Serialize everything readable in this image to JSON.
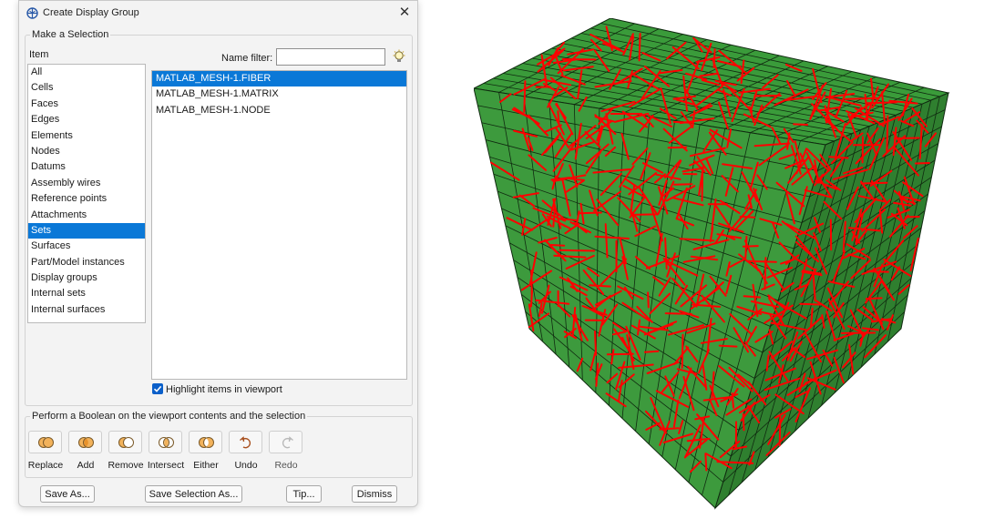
{
  "dialog": {
    "title": "Create Display Group",
    "make_selection": "Make a Selection",
    "item_label": "Item",
    "items": [
      "All",
      "Cells",
      "Faces",
      "Edges",
      "Elements",
      "Nodes",
      "Datums",
      "Assembly wires",
      "Reference points",
      "Attachments",
      "Sets",
      "Surfaces",
      "Part/Model instances",
      "Display groups",
      "Internal sets",
      "Internal surfaces"
    ],
    "selected_item": "Sets",
    "name_filter_label": "Name filter:",
    "name_filter_value": "",
    "sets": [
      "MATLAB_MESH-1.FIBER",
      "MATLAB_MESH-1.MATRIX",
      "MATLAB_MESH-1.NODE"
    ],
    "selected_set": "MATLAB_MESH-1.FIBER",
    "highlight_label": "Highlight items in viewport",
    "highlight_checked": true,
    "boolean_title": "Perform a Boolean on the viewport contents and the selection",
    "boolean_ops": [
      "Replace",
      "Add",
      "Remove",
      "Intersect",
      "Either",
      "Undo",
      "Redo"
    ],
    "buttons": {
      "save_as": "Save As...",
      "save_selection_as": "Save Selection As...",
      "tip": "Tip...",
      "dismiss": "Dismiss"
    }
  },
  "colors": {
    "selection": "#0a78d7",
    "cube_top": "#3a9b3a",
    "cube_left": "#3d9a3d",
    "cube_right": "#2f7f2f",
    "fiber": "#ff0000"
  },
  "viewport": {
    "model": "meshed cube with randomly oriented fibers"
  }
}
